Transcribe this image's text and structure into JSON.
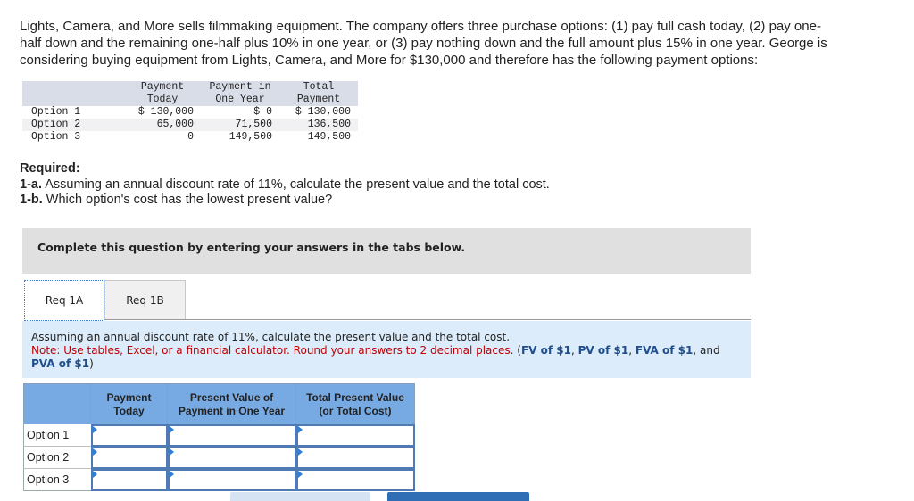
{
  "intro": {
    "text": "Lights, Camera, and More sells filmmaking equipment. The company offers three purchase options: (1) pay full cash today, (2) pay one-half down and the remaining one-half plus 10% in one year, or (3) pay nothing down and the full amount plus 15% in one year. George is considering buying equipment from Lights, Camera, and More for $130,000 and therefore has the following payment options:"
  },
  "given_table": {
    "headers": [
      {
        "line1": "",
        "line2": ""
      },
      {
        "line1": "Payment",
        "line2": "Today"
      },
      {
        "line1": "Payment in",
        "line2": "One Year"
      },
      {
        "line1": "Total",
        "line2": "Payment"
      }
    ],
    "rows": [
      {
        "label": "Option 1",
        "today": "$ 130,000",
        "one_year": "$ 0",
        "total": "$ 130,000"
      },
      {
        "label": "Option 2",
        "today": "65,000",
        "one_year": "71,500",
        "total": "136,500"
      },
      {
        "label": "Option 3",
        "today": "0",
        "one_year": "149,500",
        "total": "149,500"
      }
    ]
  },
  "required": {
    "heading": "Required:",
    "items": [
      {
        "tag": "1-a.",
        "text": " Assuming an annual discount rate of 11%, calculate the present value and the total cost."
      },
      {
        "tag": "1-b.",
        "text": " Which option's cost has the lowest present value?"
      }
    ]
  },
  "banner": {
    "text": "Complete this question by entering your answers in the tabs below."
  },
  "tabs": [
    {
      "label": "Req 1A",
      "active": true
    },
    {
      "label": "Req 1B",
      "active": false
    }
  ],
  "instructions": {
    "line1": "Assuming an annual discount rate of 11%, calculate the present value and the total cost.",
    "note": "Note: Use tables, Excel, or a financial calculator. Round your answers to 2 decimal places.",
    "open_paren": " (",
    "links": [
      "FV of $1",
      "PV of $1",
      "FVA of $1",
      "PVA of $1"
    ],
    "sep1": ", ",
    "sep2": ", ",
    "sep3": ", and ",
    "close_paren": ")"
  },
  "answer_table": {
    "headers": [
      {
        "line1": "",
        "line2": ""
      },
      {
        "line1": "Payment",
        "line2": "Today"
      },
      {
        "line1": "Present Value of",
        "line2": "Payment in One Year"
      },
      {
        "line1": "Total Present Value",
        "line2": "(or Total Cost)"
      }
    ],
    "rows": [
      {
        "label": "Option 1",
        "values": [
          "",
          "",
          ""
        ]
      },
      {
        "label": "Option 2",
        "values": [
          "",
          "",
          ""
        ]
      },
      {
        "label": "Option 3",
        "values": [
          "",
          "",
          ""
        ]
      }
    ]
  },
  "colors": {
    "banner_bg": "#e0e0e0",
    "info_bg": "#dcecfa",
    "note_red": "#c00000",
    "link_blue": "#1f4e8c",
    "header_blue": "#77aae3",
    "cell_border": "#4f7ab3",
    "next_button": "#2f6eb5",
    "prev_button": "#d5e3f2"
  }
}
